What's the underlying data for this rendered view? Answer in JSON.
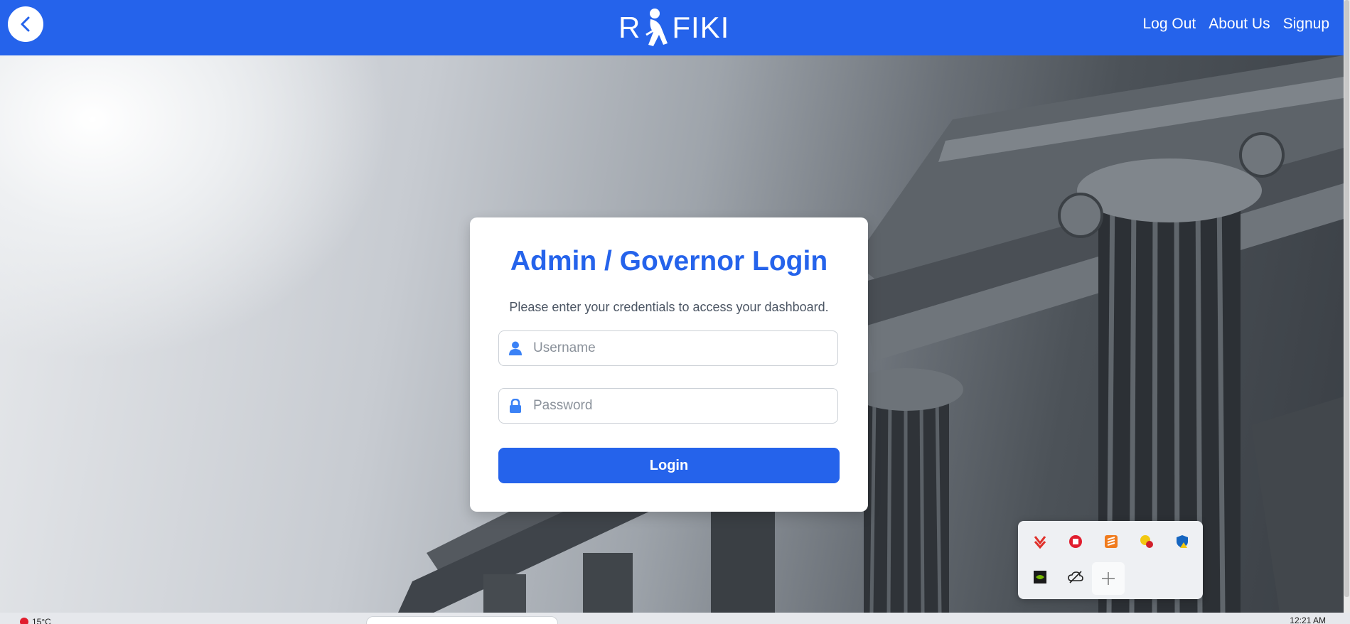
{
  "header": {
    "brand_left": "R",
    "brand_right": "FIKI",
    "nav": [
      {
        "label": "Log Out"
      },
      {
        "label": "About Us"
      },
      {
        "label": "Signup"
      }
    ]
  },
  "login": {
    "title": "Admin / Governor Login",
    "subtitle": "Please enter your credentials to access your dashboard.",
    "username_placeholder": "Username",
    "password_placeholder": "Password",
    "button_label": "Login"
  },
  "colors": {
    "primary": "#2563eb"
  },
  "taskbar": {
    "weather": "15°C",
    "time": "12:21 AM"
  }
}
